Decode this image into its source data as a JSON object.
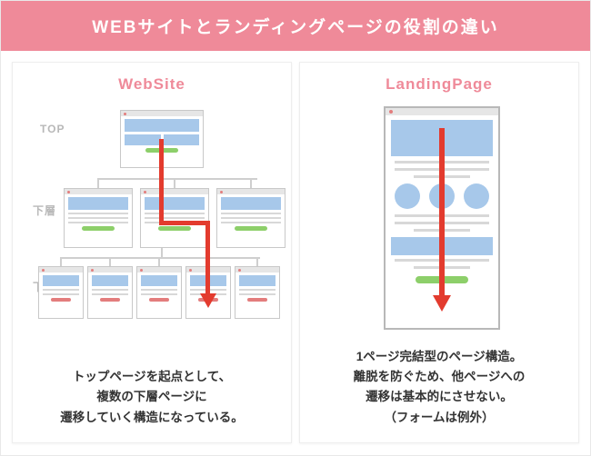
{
  "header": {
    "title": "WEBサイトとランディングページの役割の違い"
  },
  "website": {
    "title": "WebSite",
    "levels": {
      "top": "TOP",
      "mid": "下層",
      "bot": "下層"
    },
    "caption": "トップページを起点として、\n複数の下層ページに\n遷移していく構造になっている。"
  },
  "landing": {
    "title": "LandingPage",
    "caption": "1ページ完結型のページ構造。\n離脱を防ぐため、他ページへの\n遷移は基本的にさせない。\n（フォームは例外）"
  },
  "colors": {
    "accent": "#ef8a99",
    "arrow": "#e33b2e",
    "block": "#a7c8ea",
    "cta": "#8dcf6a"
  }
}
